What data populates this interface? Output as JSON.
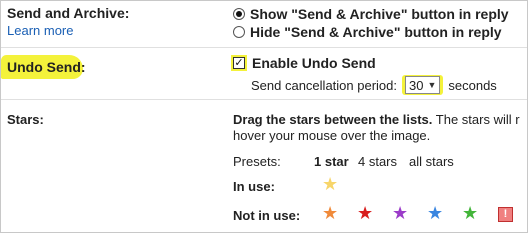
{
  "send_archive": {
    "label": "Send and Archive:",
    "learn_more": "Learn more",
    "options": [
      {
        "label": "Show \"Send & Archive\" button in reply",
        "selected": true
      },
      {
        "label": "Hide \"Send & Archive\" button in reply",
        "selected": false
      }
    ]
  },
  "undo_send": {
    "label": "Undo Send:",
    "checkbox_label": "Enable Undo Send",
    "checked": true,
    "period_label": "Send cancellation period:",
    "period_value": "30",
    "period_unit": "seconds",
    "highlight_color": "#f4f23b"
  },
  "stars": {
    "label": "Stars:",
    "instruction_bold": "Drag the stars between the lists.",
    "instruction_rest": "The stars will r",
    "instruction_line2": "hover your mouse over the image.",
    "presets_label": "Presets:",
    "presets": [
      {
        "label": "1 star",
        "active": true
      },
      {
        "label": "4 stars",
        "active": false
      },
      {
        "label": "all stars",
        "active": false
      }
    ],
    "in_use_label": "In use:",
    "in_use": [
      {
        "icon": "yellow-star-icon",
        "color": "#f7d56a"
      }
    ],
    "not_in_use_label": "Not in use:",
    "not_in_use": [
      {
        "icon": "orange-star-icon",
        "color": "#f08a3a"
      },
      {
        "icon": "red-star-icon",
        "color": "#d81e1e"
      },
      {
        "icon": "purple-star-icon",
        "color": "#9b3cc9"
      },
      {
        "icon": "blue-star-icon",
        "color": "#3a86e0"
      },
      {
        "icon": "green-star-icon",
        "color": "#43b53a"
      },
      {
        "icon": "red-bang-icon",
        "color": "#f08080",
        "glyph": "!"
      }
    ]
  },
  "colors": {
    "link": "#1a5fb4",
    "separator": "#e0e0e0"
  }
}
